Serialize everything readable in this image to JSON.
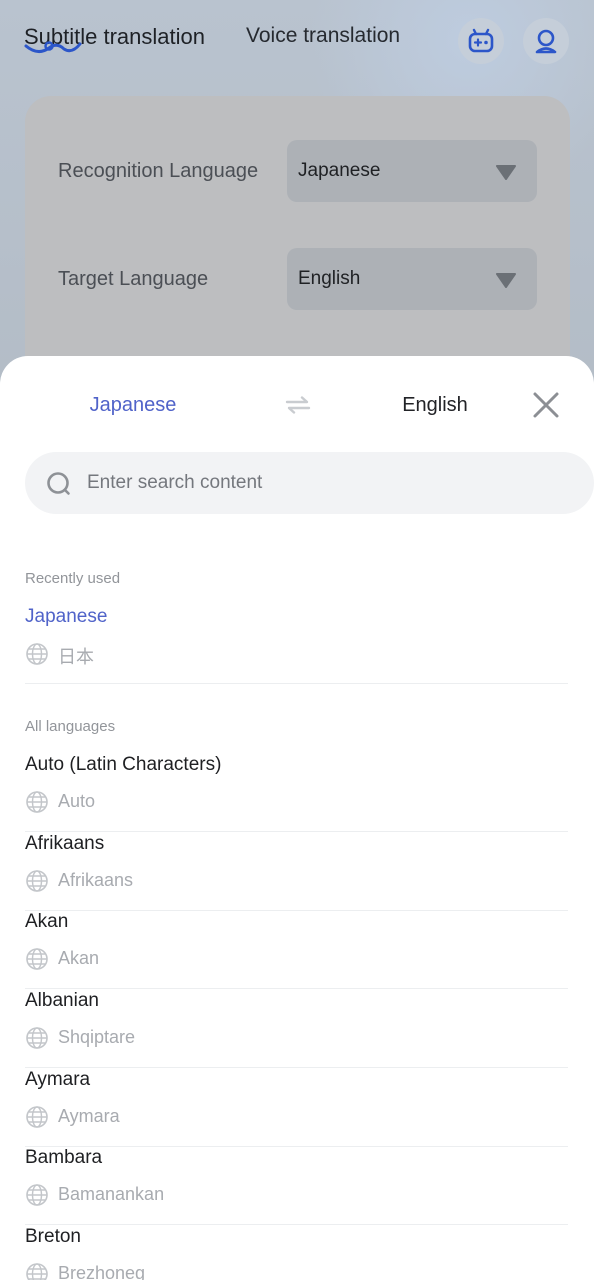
{
  "background": {
    "tabs": {
      "subtitle": "Subtitle translation",
      "voice": "Voice translation"
    },
    "settings": {
      "recognition_label": "Recognition Language",
      "recognition_value": "Japanese",
      "target_label": "Target Language",
      "target_value": "English"
    }
  },
  "sheet": {
    "source_language": "Japanese",
    "target_language": "English",
    "search": {
      "placeholder": "Enter search content"
    },
    "recent_title": "Recently used",
    "recent": [
      {
        "name": "Japanese",
        "native": "日本"
      }
    ],
    "all_title": "All languages",
    "languages": [
      {
        "name": "Auto (Latin Characters)",
        "native": "Auto"
      },
      {
        "name": "Afrikaans",
        "native": "Afrikaans"
      },
      {
        "name": "Akan",
        "native": "Akan"
      },
      {
        "name": "Albanian",
        "native": "Shqiptare"
      },
      {
        "name": "Aymara",
        "native": "Aymara"
      },
      {
        "name": "Bambara",
        "native": "Bamanankan"
      },
      {
        "name": "Breton",
        "native": "Brezhoneg"
      }
    ]
  },
  "colors": {
    "accent": "#5063c9",
    "brand_blue": "#2c56c9"
  },
  "icons": [
    "game-icon",
    "user-icon",
    "dropdown-arrow-icon",
    "swap-icon",
    "close-icon",
    "search-icon",
    "globe-icon"
  ]
}
